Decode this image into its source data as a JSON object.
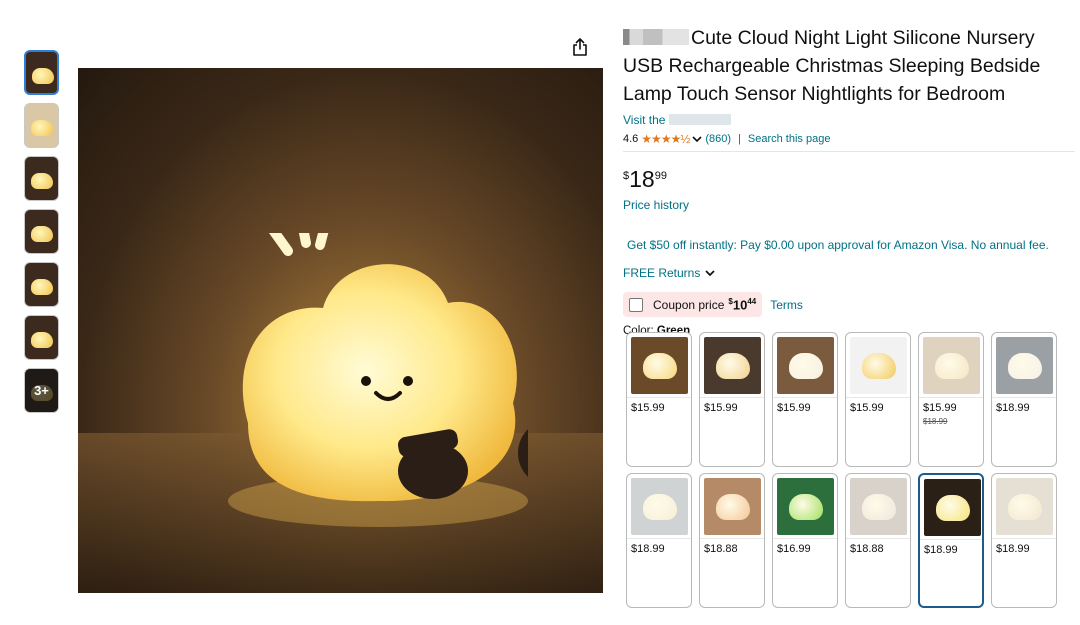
{
  "product": {
    "title": "Cute Cloud Night Light Silicone Nursery USB Rechargeable Christmas Sleeping Bedside Lamp Touch Sensor Nightlights for Bedroom",
    "visit_text": "Visit the",
    "rating": "4.6",
    "stars": "★★★★½",
    "review_count": "(860)",
    "search_link": "Search this page",
    "price_symbol": "$",
    "price_whole": "18",
    "price_fraction": "99",
    "price_history": "Price history",
    "offer_text": "Get $50 off instantly: Pay $0.00 upon approval for Amazon Visa. No annual fee.",
    "returns": "FREE Returns",
    "coupon_label": "Coupon price",
    "coupon_symbol": "$",
    "coupon_whole": "10",
    "coupon_fraction": "44",
    "terms": "Terms",
    "color_label": "Color:",
    "color_value": "Green"
  },
  "thumbnails": {
    "more_label": "3+"
  },
  "swatches": [
    {
      "price": "$15.99",
      "old_price": ""
    },
    {
      "price": "$15.99",
      "old_price": ""
    },
    {
      "price": "$15.99",
      "old_price": ""
    },
    {
      "price": "$15.99",
      "old_price": ""
    },
    {
      "price": "$15.99",
      "old_price": "$18.99"
    },
    {
      "price": "$18.99",
      "old_price": ""
    },
    {
      "price": "$18.99",
      "old_price": ""
    },
    {
      "price": "$18.88",
      "old_price": ""
    },
    {
      "price": "$16.99",
      "old_price": ""
    },
    {
      "price": "$18.88",
      "old_price": ""
    },
    {
      "price": "$18.99",
      "old_price": ""
    },
    {
      "price": "$18.99",
      "old_price": ""
    }
  ],
  "colors": {
    "link": "#007185",
    "star": "#de7921",
    "coupon_bg": "#fce6e6",
    "selected_border": "#1e5b8a"
  }
}
